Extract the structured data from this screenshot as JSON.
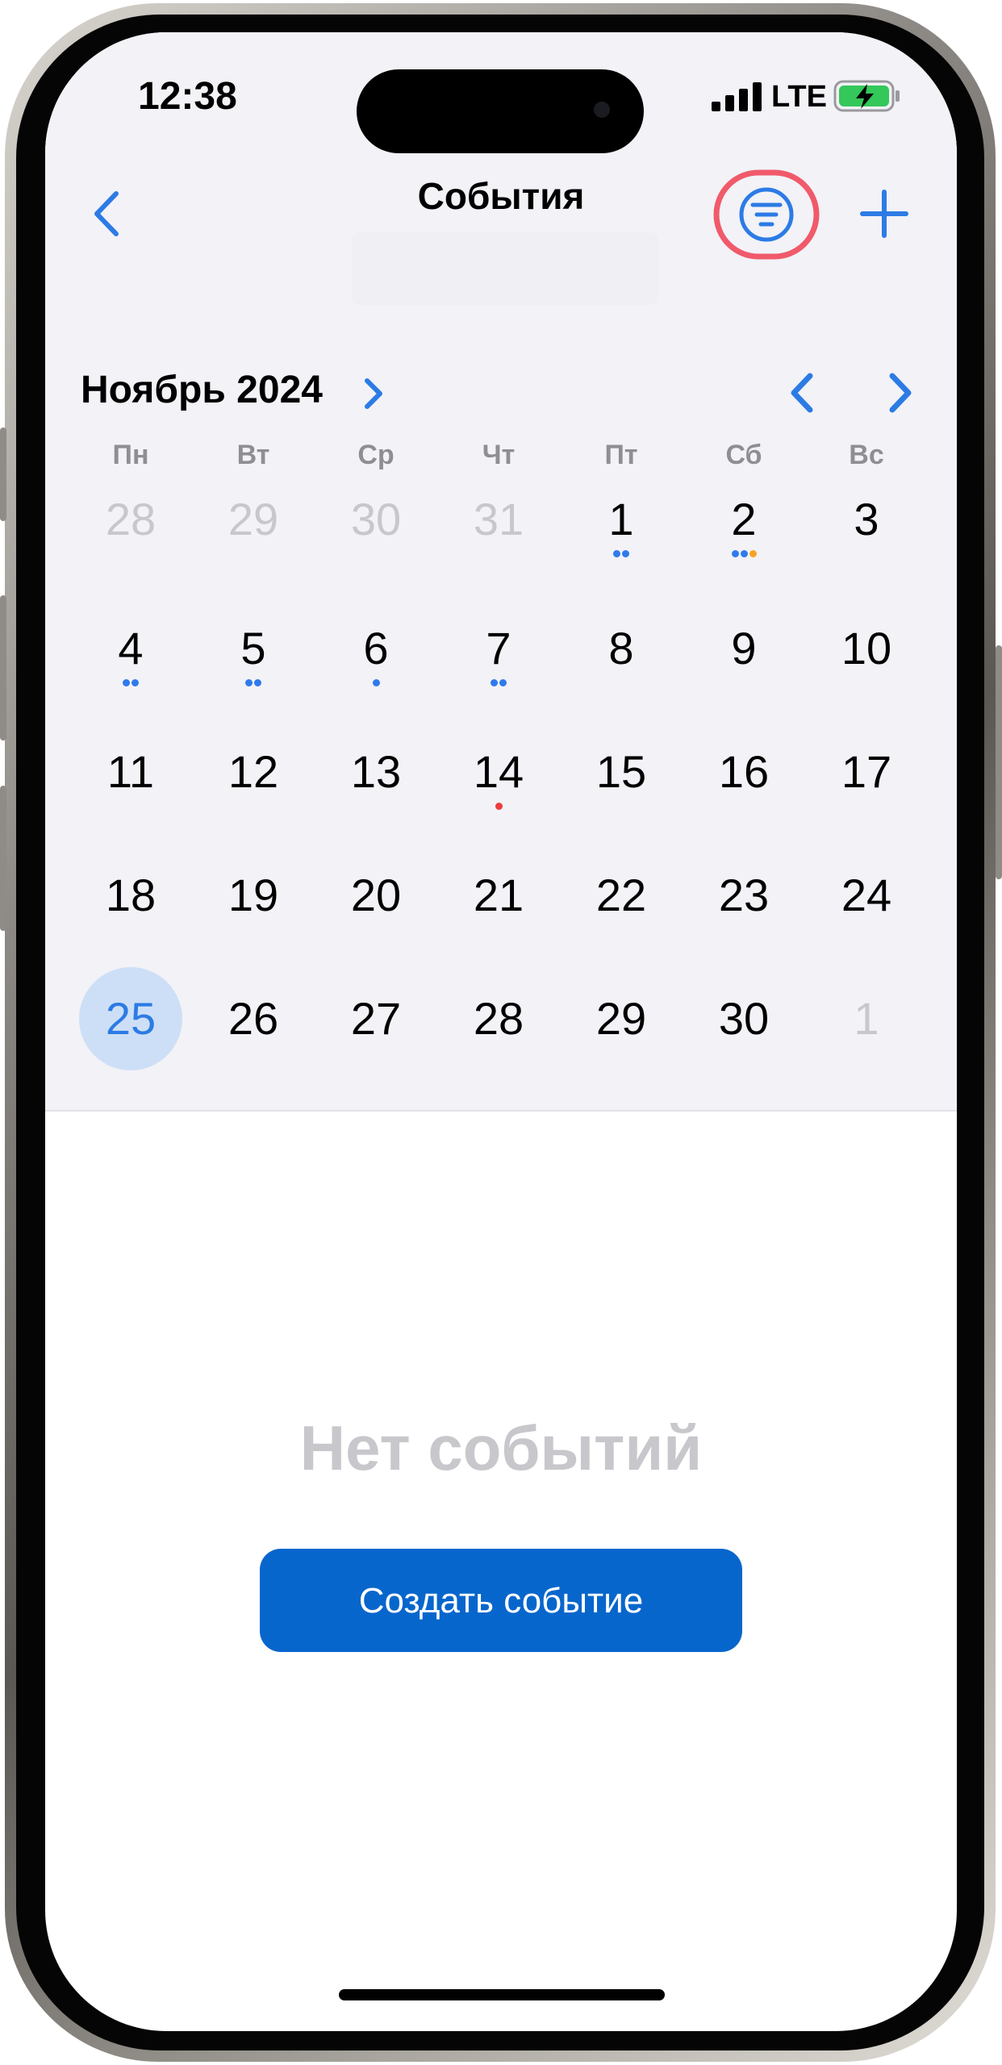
{
  "status_bar": {
    "time": "12:38",
    "network": "LTE"
  },
  "nav": {
    "title": "События"
  },
  "calendar": {
    "month_label": "Ноябрь 2024",
    "weekdays": [
      "Пн",
      "Вт",
      "Ср",
      "Чт",
      "Пт",
      "Сб",
      "Вс"
    ],
    "weeks": [
      [
        {
          "day": "28",
          "other": true
        },
        {
          "day": "29",
          "other": true
        },
        {
          "day": "30",
          "other": true
        },
        {
          "day": "31",
          "other": true
        },
        {
          "day": "1",
          "dots": [
            "#2f7bea",
            "#2f7bea"
          ]
        },
        {
          "day": "2",
          "dots": [
            "#2f7bea",
            "#2f7bea",
            "#f5a524"
          ]
        },
        {
          "day": "3"
        }
      ],
      [
        {
          "day": "4",
          "dots": [
            "#2f7bea",
            "#2f7bea"
          ]
        },
        {
          "day": "5",
          "dots": [
            "#2f7bea",
            "#2f7bea"
          ]
        },
        {
          "day": "6",
          "dots": [
            "#2f7bea"
          ]
        },
        {
          "day": "7",
          "dots": [
            "#2f7bea",
            "#2f7bea"
          ]
        },
        {
          "day": "8"
        },
        {
          "day": "9"
        },
        {
          "day": "10"
        }
      ],
      [
        {
          "day": "11"
        },
        {
          "day": "12"
        },
        {
          "day": "13"
        },
        {
          "day": "14",
          "dots": [
            "#ef3b3b"
          ]
        },
        {
          "day": "15"
        },
        {
          "day": "16"
        },
        {
          "day": "17"
        }
      ],
      [
        {
          "day": "18"
        },
        {
          "day": "19"
        },
        {
          "day": "20"
        },
        {
          "day": "21"
        },
        {
          "day": "22"
        },
        {
          "day": "23"
        },
        {
          "day": "24"
        }
      ],
      [
        {
          "day": "25",
          "selected": true
        },
        {
          "day": "26"
        },
        {
          "day": "27"
        },
        {
          "day": "28"
        },
        {
          "day": "29"
        },
        {
          "day": "30"
        },
        {
          "day": "1",
          "other": true
        }
      ]
    ]
  },
  "empty_state": {
    "message": "Нет событий",
    "button_label": "Создать событие"
  },
  "colors": {
    "accent": "#2c7be5",
    "button": "#0766cc",
    "highlight_ring": "#f05a6b",
    "selected_bg": "#cddff6",
    "battery_fill": "#34c759"
  },
  "icons": {
    "back": "chevron-left-icon",
    "filter": "filter-lines-icon",
    "add": "plus-icon",
    "month_expand": "chevron-right-icon",
    "prev": "chevron-left-icon",
    "next": "chevron-right-icon"
  }
}
